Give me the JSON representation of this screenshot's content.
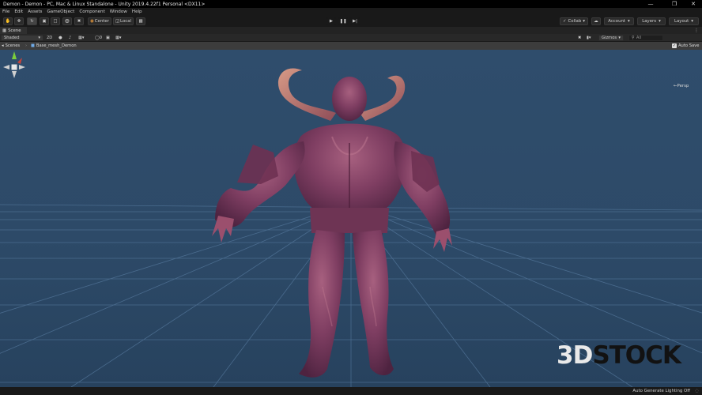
{
  "window": {
    "title": "Demon - Demon - PC, Mac & Linux Standalone - Unity 2019.4.22f1 Personal <DX11>",
    "controls": [
      "minimize-icon",
      "restore-icon",
      "close-icon"
    ]
  },
  "menu": [
    "File",
    "Edit",
    "Assets",
    "GameObject",
    "Component",
    "Window",
    "Help"
  ],
  "toolbar": {
    "tools": [
      "hand-tool-icon",
      "move-tool-icon",
      "rotate-tool-icon",
      "scale-tool-icon",
      "rect-tool-icon",
      "transform-tool-icon",
      "custom-tool-icon"
    ],
    "pivot_label": "Center",
    "space_label": "Local",
    "play_controls": [
      "play-icon",
      "pause-icon",
      "step-icon"
    ],
    "collab_label": "Collab",
    "account_label": "Account",
    "layers_label": "Layers",
    "layout_label": "Layout"
  },
  "scene_tab": {
    "label": "Scene"
  },
  "scene_toolbar": {
    "shading_mode": "Shaded",
    "mode_2d_label": "2D",
    "gizmos_label": "Gizmos",
    "search_placeholder": "All"
  },
  "breadcrumb": {
    "root_label": "Scenes",
    "prefab_label": "Base_mesh_Demon",
    "auto_save_label": "Auto Save",
    "auto_save_checked": true
  },
  "viewport": {
    "projection_label": "←Persp",
    "watermark_part1": "3D",
    "watermark_part2": "STOCK"
  },
  "status": {
    "lighting_text": "Auto Generate Lighting Off"
  },
  "colors": {
    "sky_top": "#2f4d6c",
    "grid_line": "#5a7ea3",
    "model_flesh": "#8a4a6e",
    "gizmo_x": "#c8433a",
    "gizmo_y": "#7ccf3c",
    "gizmo_z": "#3f6fd1"
  }
}
